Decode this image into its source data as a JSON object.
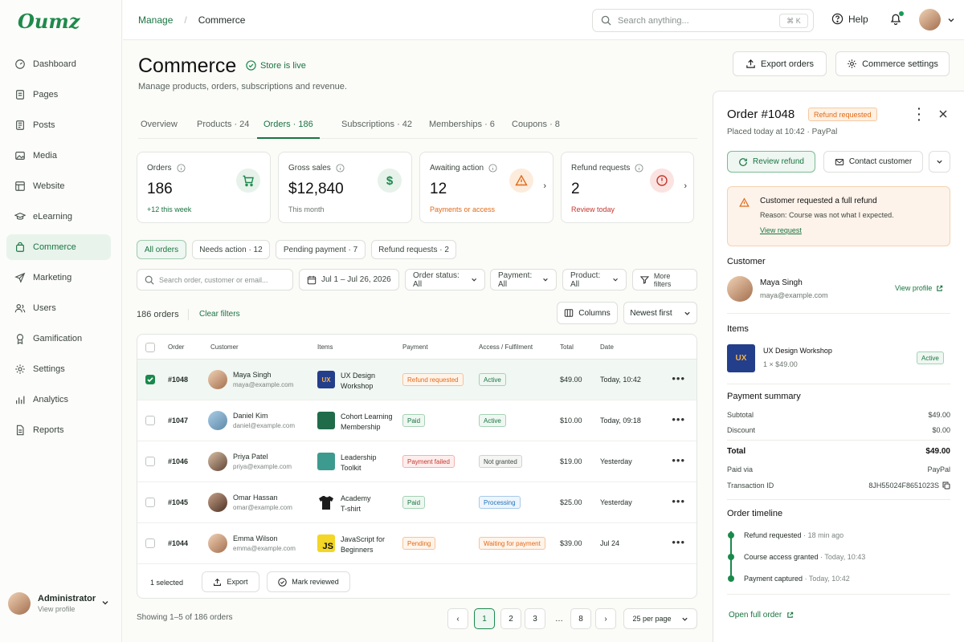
{
  "brand": {
    "logo": "Oumz",
    "accent": "#1a7441"
  },
  "sidebar": {
    "items": [
      {
        "label": "Dashboard",
        "icon": "dashboard-icon"
      },
      {
        "label": "Pages",
        "icon": "pages-icon"
      },
      {
        "label": "Posts",
        "icon": "posts-icon"
      },
      {
        "label": "Media",
        "icon": "media-icon"
      },
      {
        "label": "Website",
        "icon": "website-icon"
      },
      {
        "label": "eLearning",
        "icon": "graduation-cap-icon"
      },
      {
        "label": "Commerce",
        "icon": "shopping-bag-icon",
        "active": true
      },
      {
        "label": "Marketing",
        "icon": "send-icon"
      },
      {
        "label": "Users",
        "icon": "users-icon"
      },
      {
        "label": "Gamification",
        "icon": "award-icon"
      },
      {
        "label": "Settings",
        "icon": "gear-icon"
      },
      {
        "label": "Analytics",
        "icon": "bar-chart-icon"
      },
      {
        "label": "Reports",
        "icon": "report-icon"
      }
    ],
    "admin": {
      "name": "Administrator",
      "sub": "View profile"
    }
  },
  "topbar": {
    "breadcrumb": [
      "Manage",
      "Commerce"
    ],
    "search_placeholder": "Search anything...",
    "shortcut": "⌘ K",
    "help": "Help"
  },
  "page": {
    "title": "Commerce",
    "status": "Store is live",
    "subtitle": "Manage products, orders, subscriptions and revenue.",
    "export": "Export orders",
    "settings": "Commerce settings"
  },
  "tabs": [
    {
      "label": "Overview"
    },
    {
      "label": "Products · 24"
    },
    {
      "label": "Orders · 186",
      "active": true
    },
    {
      "label": "Subscriptions · 42"
    },
    {
      "label": "Memberships · 6"
    },
    {
      "label": "Coupons · 8"
    }
  ],
  "stats": [
    {
      "label": "Orders",
      "value": "186",
      "note": "+12 this week",
      "note_color": "#1a7441"
    },
    {
      "label": "Gross sales",
      "value": "$12,840",
      "note": "This month",
      "note_color": "#6b756f"
    },
    {
      "label": "Awaiting action",
      "value": "12",
      "note": "Payments or access",
      "note_color": "#e06a18"
    },
    {
      "label": "Refund requests",
      "value": "2",
      "note": "Review today",
      "note_color": "#c4372f"
    }
  ],
  "chips": [
    "All orders",
    "Needs action · 12",
    "Pending payment · 7",
    "Refund requests · 2"
  ],
  "filters": {
    "search_placeholder": "Search order, customer or email...",
    "date": "Jul 1 – Jul 26, 2026",
    "status": "Order status: All",
    "payment": "Payment: All",
    "product": "Product: All",
    "more": "More filters"
  },
  "list": {
    "count": "186 orders",
    "clear": "Clear filters",
    "columns": "Columns",
    "sort": "Newest first"
  },
  "table": {
    "headers": [
      "Order",
      "Customer",
      "Items",
      "Payment",
      "Access / Fulfilment",
      "Total",
      "Date"
    ],
    "rows": [
      {
        "id": "#1048",
        "name": "Maya Singh",
        "email": "maya@example.com",
        "item": [
          "UX Design",
          "Workshop"
        ],
        "payment": "Refund requested",
        "pay_cls": "p-orange",
        "access": "Active",
        "acc_cls": "p-green",
        "total": "$49.00",
        "date": "Today, 10:42",
        "selected": true
      },
      {
        "id": "#1047",
        "name": "Daniel Kim",
        "email": "daniel@example.com",
        "item": [
          "Cohort Learning",
          "Membership"
        ],
        "payment": "Paid",
        "pay_cls": "p-green",
        "access": "Active",
        "acc_cls": "p-green",
        "total": "$10.00",
        "date": "Today, 09:18"
      },
      {
        "id": "#1046",
        "name": "Priya Patel",
        "email": "priya@example.com",
        "item": [
          "Leadership",
          "Toolkit"
        ],
        "payment": "Payment failed",
        "pay_cls": "p-red",
        "access": "Not granted",
        "acc_cls": "p-gray",
        "total": "$19.00",
        "date": "Yesterday"
      },
      {
        "id": "#1045",
        "name": "Omar Hassan",
        "email": "omar@example.com",
        "item": [
          "Academy",
          "T-shirt"
        ],
        "payment": "Paid",
        "pay_cls": "p-green",
        "access": "Processing",
        "acc_cls": "p-blue",
        "total": "$25.00",
        "date": "Yesterday"
      },
      {
        "id": "#1044",
        "name": "Emma Wilson",
        "email": "emma@example.com",
        "item": [
          "JavaScript for",
          "Beginners"
        ],
        "payment": "Pending",
        "pay_cls": "p-orange",
        "access": "Waiting for payment",
        "acc_cls": "p-orange",
        "total": "$39.00",
        "date": "Jul 24"
      }
    ],
    "footer": {
      "selected": "1 selected",
      "export": "Export",
      "mark": "Mark reviewed"
    }
  },
  "pagination": {
    "showing": "Showing 1–5 of 186 orders",
    "pages": [
      "1",
      "2",
      "3",
      "…",
      "8"
    ],
    "per_page": "25 per page"
  },
  "panel": {
    "title": "Order #1048",
    "badge": "Refund requested",
    "sub": "Placed today at 10:42 · PayPal",
    "review": "Review refund",
    "contact": "Contact customer",
    "alert": {
      "title": "Customer requested a full refund",
      "reason": "Reason: Course was not what I expected.",
      "link": "View request"
    },
    "customer_label": "Customer",
    "customer": {
      "name": "Maya Singh",
      "email": "maya@example.com",
      "link": "View profile"
    },
    "items_label": "Items",
    "item": {
      "name": "UX Design Workshop",
      "qty": "1 × $49.00",
      "status": "Active"
    },
    "payment_label": "Payment summary",
    "summary": [
      {
        "k": "Subtotal",
        "v": "$49.00"
      },
      {
        "k": "Discount",
        "v": "$0.00"
      },
      {
        "k": "Total",
        "v": "$49.00"
      },
      {
        "k": "Paid via",
        "v": "PayPal"
      },
      {
        "k": "Transaction ID",
        "v": "8JH55024F8651023S"
      }
    ],
    "timeline_label": "Order timeline",
    "timeline": [
      {
        "event": "Refund requested",
        "time": "· 18 min ago"
      },
      {
        "event": "Course access granted",
        "time": "· Today, 10:43"
      },
      {
        "event": "Payment captured",
        "time": "· Today, 10:42"
      }
    ],
    "open_full": "Open full order"
  }
}
